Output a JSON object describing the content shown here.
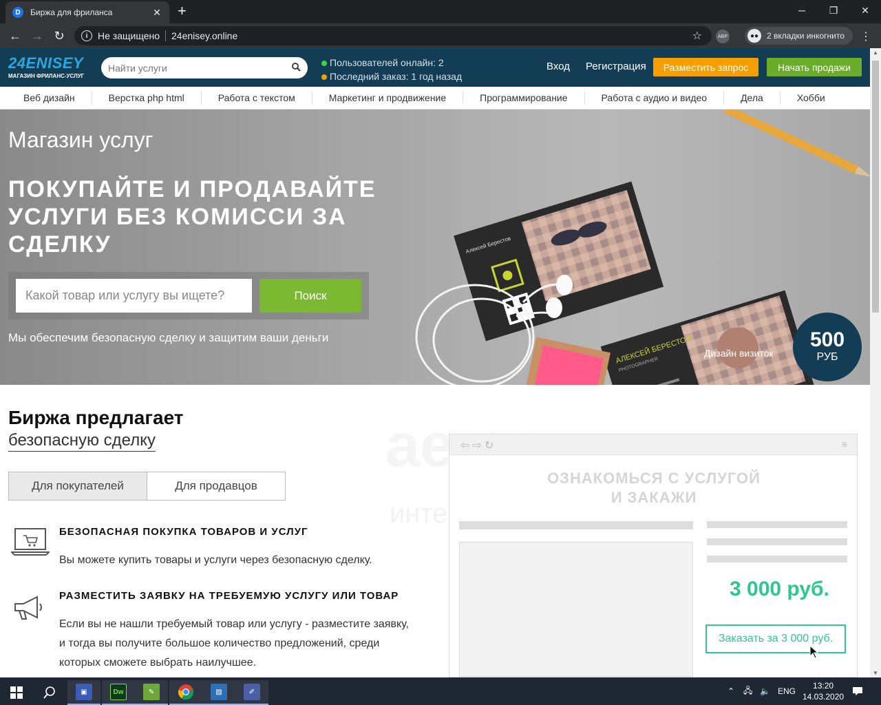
{
  "browser": {
    "tab_title": "Биржа для фриланса",
    "tab_favicon": "D",
    "security_label": "Не защищено",
    "url": "24enisey.online",
    "extension_label": "ABP",
    "incognito_label": "2 вкладки инкогнито"
  },
  "header": {
    "logo_main": "24ENISEY",
    "logo_tagline": "МАГАЗИН ФРИЛАНС-УСЛУГ",
    "search_placeholder": "Найти услуги",
    "stats_online": "Пользователей онлайн: 2",
    "stats_last_order": "Последний заказ: 1 год назад",
    "login": "Вход",
    "register": "Регистрация",
    "post_request": "Разместить запрос",
    "start_selling": "Начать продажи",
    "colors": {
      "bg": "#123d55",
      "orange": "#f5a000",
      "green": "#6bac2a"
    }
  },
  "categories": [
    "Веб дизайн",
    "Верстка php html",
    "Работа с текстом",
    "Маркетинг и продвижение",
    "Программирование",
    "Работа с аудио и видео",
    "Дела",
    "Хобби"
  ],
  "hero": {
    "title": "Магазин услуг",
    "headline": "ПОКУПАЙТЕ И ПРОДАВАЙТЕ УСЛУГИ БЕЗ КОМИССИ ЗА СДЕЛКУ",
    "search_placeholder": "Какой товар или услугу вы ищете?",
    "search_button": "Поиск",
    "subtitle": "Мы обеспечим безопасную сделку и защитим ваши деньги",
    "featured_label": "Дизайн визиток",
    "price_value": "500",
    "price_currency": "РУБ",
    "card1_name": "Алексей Берестов",
    "card2_name": "АЛЕКСЕЙ БЕРЕСТОВ",
    "card2_role": "PHOTOGRAPHER"
  },
  "section": {
    "title": "Биржа предлагает",
    "subtitle": "безопасную сделку",
    "tab_buyers": "Для покупателей",
    "tab_sellers": "Для продавцов",
    "feature1_title": "БЕЗОПАСНАЯ ПОКУПКА ТОВАРОВ И УСЛУГ",
    "feature1_text": "Вы можете купить товары и услуги через безопасную сделку.",
    "feature2_title": "РАЗМЕСТИТЬ ЗАЯВКУ НА ТРЕБУЕМУЮ УСЛУГУ ИЛИ ТОВАР",
    "feature2_text": "Если вы не нашли требуемый товар или услугу - разместите заявку, и тогда вы получите большое количество предложений, среди которых сможете выбрать наилучшее."
  },
  "mockup": {
    "title_line1": "ОЗНАКОМЬСЯ С УСЛУГОЙ",
    "title_line2": "И ЗАКАЖИ",
    "price": "3 000 руб.",
    "order_button": "Заказать за 3 000 руб.",
    "watermark_text": "интернет-аукцион"
  },
  "taskbar": {
    "language": "ENG",
    "time": "13:20",
    "date": "14.03.2020"
  }
}
